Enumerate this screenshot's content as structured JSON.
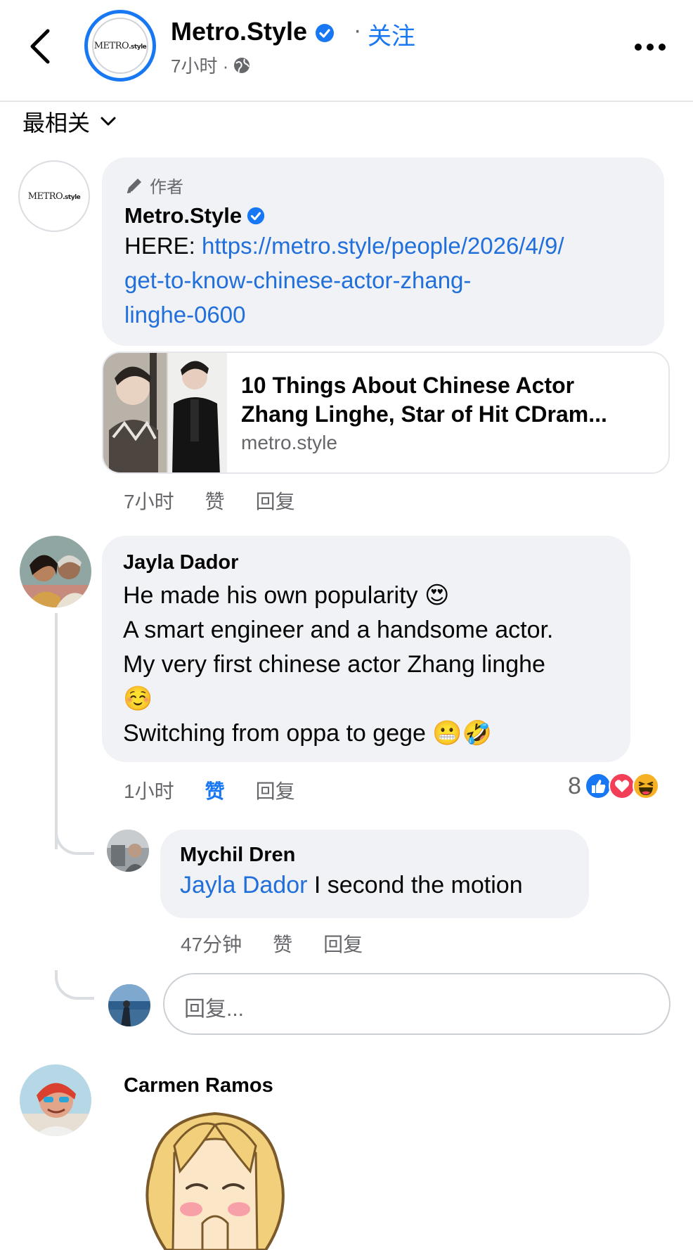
{
  "header": {
    "back_icon": "chevron-left-icon",
    "page_name": "Metro.Style",
    "logo_text_main": "METRO",
    "logo_text_small": ".style",
    "separator": "·",
    "follow_label": "关注",
    "post_time": "7小时 ·",
    "privacy_icon": "globe-icon",
    "more_icon": "more-horizontal-icon"
  },
  "sort": {
    "label": "最相关",
    "icon": "chevron-down-icon"
  },
  "comments": [
    {
      "badge": "作者",
      "badge_icon": "pen-icon",
      "author": "Metro.Style",
      "text_prefix": "HERE: ",
      "link_lines": [
        "https://metro.style/people/2026/4/9/",
        "get-to-know-chinese-actor-zhang-",
        "linghe-0600"
      ],
      "preview": {
        "title_line1": "10 Things About Chinese Actor",
        "title_line2": "Zhang Linghe, Star of Hit CDram...",
        "domain": "metro.style"
      },
      "time": "7小时",
      "like_label": "赞",
      "reply_label": "回复"
    },
    {
      "author": "Jayla Dador",
      "lines": [
        "He made  his own popularity 😍",
        "A smart engineer and a handsome actor.",
        "My very first chinese actor Zhang linghe",
        "☺️",
        "Switching from oppa to gege 😬🤣"
      ],
      "time": "1小时",
      "like_label": "赞",
      "reply_label": "回复",
      "reaction_count": "8",
      "reaction_icons": [
        "like-reaction-icon",
        "love-reaction-icon",
        "haha-reaction-icon"
      ],
      "replies": [
        {
          "author": "Mychil Dren",
          "mention": "Jayla Dador",
          "text": " I second the motion",
          "time": "47分钟",
          "like_label": "赞",
          "reply_label": "回复"
        }
      ],
      "reply_placeholder": "回复..."
    },
    {
      "author": "Carmen Ramos"
    }
  ],
  "colors": {
    "accent": "#1877f2",
    "link": "#216fdb",
    "bubble": "#f0f2f5",
    "meta": "#65676b"
  }
}
